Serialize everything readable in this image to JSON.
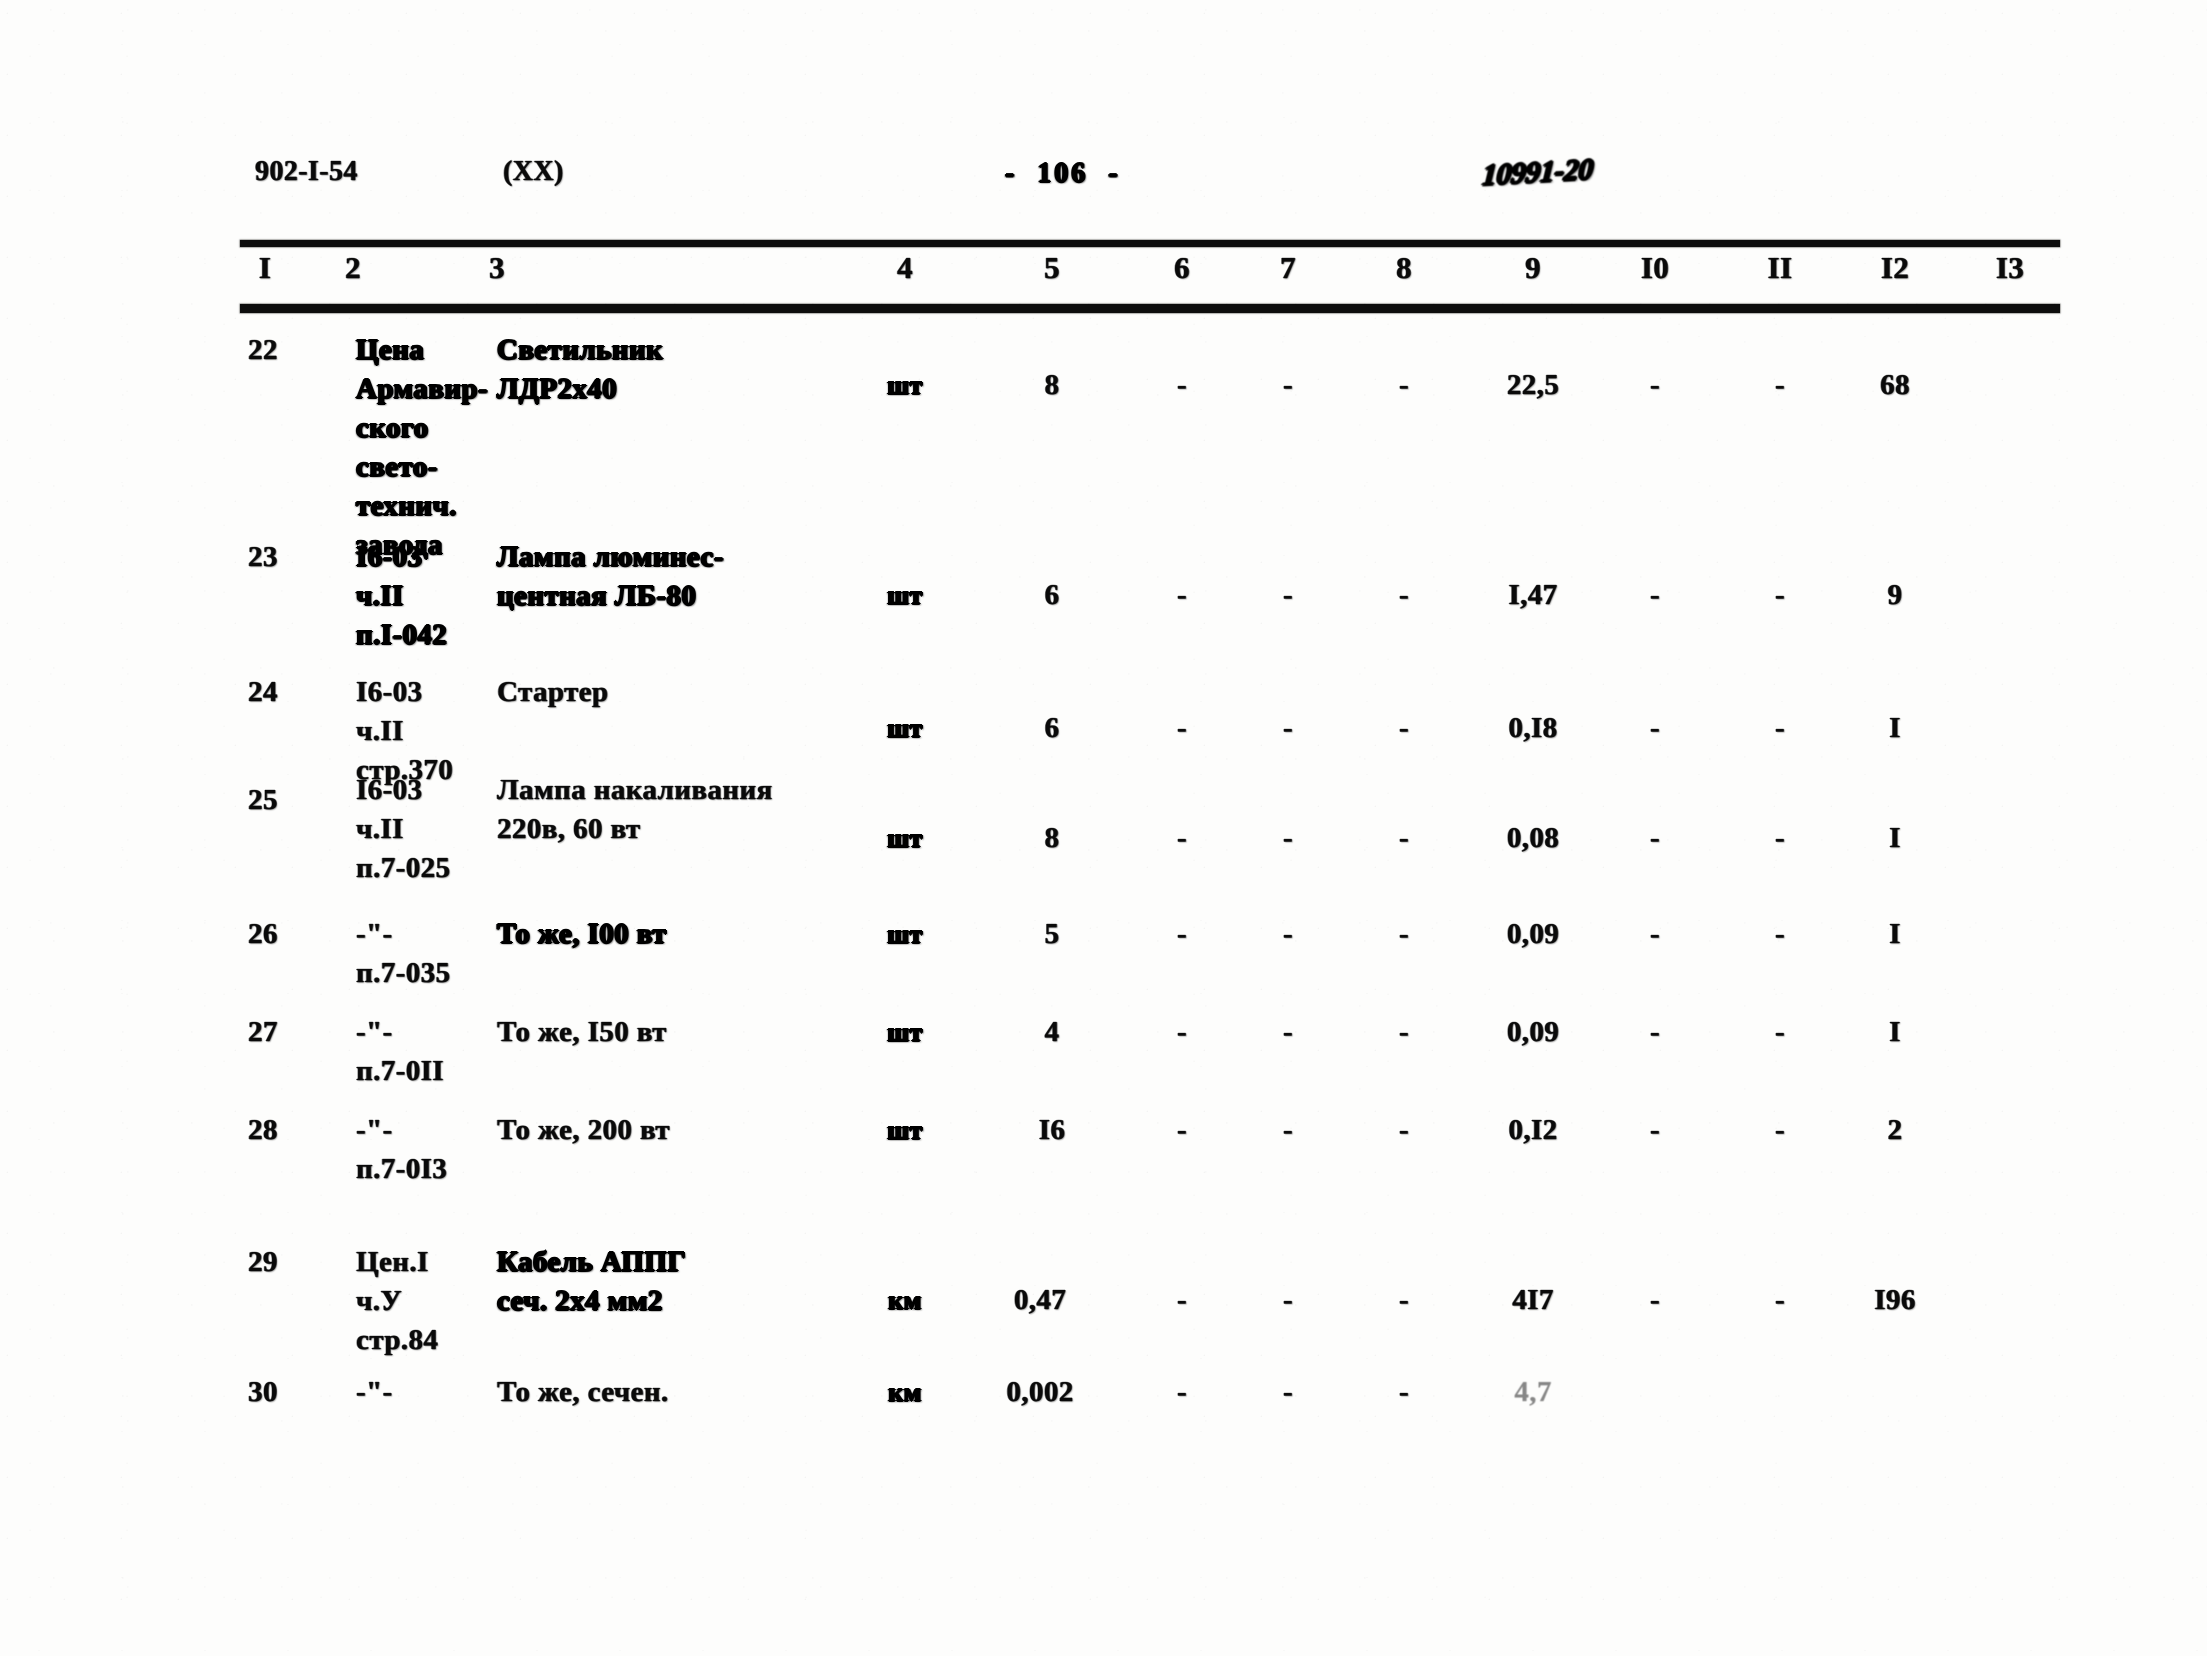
{
  "document": {
    "code": "902-I-54",
    "part": "(XX)",
    "page_marker": "-  106  -",
    "stamp": "10991-20"
  },
  "table": {
    "column_headers": [
      "I",
      "2",
      "3",
      "4",
      "5",
      "6",
      "7",
      "8",
      "9",
      "I0",
      "II",
      "I2",
      "I3"
    ],
    "rows": [
      {
        "num": "22",
        "code": "Цена\nАрмавир-\nского\nсвето-\nтехнич.\nзавода",
        "name": "Светильник\nЛДР2х40",
        "unit": "шт",
        "c5": "8",
        "c6": "-",
        "c7": "-",
        "c8": "-",
        "c9": "22,5",
        "c10": "-",
        "c11": "-",
        "c12": "68",
        "c13": ""
      },
      {
        "num": "23",
        "code": "I6-03\nч.II\nп.I-042",
        "name": "Лампа люминес-\nцентная ЛБ-80",
        "unit": "шт",
        "c5": "6",
        "c6": "-",
        "c7": "-",
        "c8": "-",
        "c9": "I,47",
        "c10": "-",
        "c11": "-",
        "c12": "9",
        "c13": ""
      },
      {
        "num": "24",
        "code": "I6-03\nч.II\nстр.370",
        "name": "Стартер",
        "unit": "шт",
        "c5": "6",
        "c6": "-",
        "c7": "-",
        "c8": "-",
        "c9": "0,I8",
        "c10": "-",
        "c11": "-",
        "c12": "I",
        "c13": ""
      },
      {
        "num": "25",
        "code": "I6-03\nч.II\nп.7-025",
        "name": "Лампа накаливания\n220в, 60 вт",
        "unit": "шт",
        "c5": "8",
        "c6": "-",
        "c7": "-",
        "c8": "-",
        "c9": "0,08",
        "c10": "-",
        "c11": "-",
        "c12": "I",
        "c13": ""
      },
      {
        "num": "26",
        "code": "-\"-\nп.7-035",
        "name": "То же, I00 вт",
        "unit": "шт",
        "c5": "5",
        "c6": "-",
        "c7": "-",
        "c8": "-",
        "c9": "0,09",
        "c10": "-",
        "c11": "-",
        "c12": "I",
        "c13": ""
      },
      {
        "num": "27",
        "code": "-\"-\nп.7-0II",
        "name": "То же, I50 вт",
        "unit": "шт",
        "c5": "4",
        "c6": "-",
        "c7": "-",
        "c8": "-",
        "c9": "0,09",
        "c10": "-",
        "c11": "-",
        "c12": "I",
        "c13": ""
      },
      {
        "num": "28",
        "code": "-\"-\nп.7-0I3",
        "name": "То же, 200 вт",
        "unit": "шт",
        "c5": "I6",
        "c6": "-",
        "c7": "-",
        "c8": "-",
        "c9": "0,I2",
        "c10": "-",
        "c11": "-",
        "c12": "2",
        "c13": ""
      },
      {
        "num": "29",
        "code": "Цен.I\nч.У\nстр.84",
        "name": "Кабель АППГ\nсеч. 2х4 мм2",
        "unit": "км",
        "c5": "0,47",
        "c6": "-",
        "c7": "-",
        "c8": "-",
        "c9": "4I7",
        "c10": "-",
        "c11": "-",
        "c12": "I96",
        "c13": ""
      },
      {
        "num": "30",
        "code": "-\"-",
        "name": "То же, сечен.",
        "unit": "км",
        "c5": "0,002",
        "c6": "-",
        "c7": "-",
        "c8": "-",
        "c9": "4,7",
        "c10": "",
        "c11": "",
        "c12": "",
        "c13": ""
      }
    ]
  }
}
